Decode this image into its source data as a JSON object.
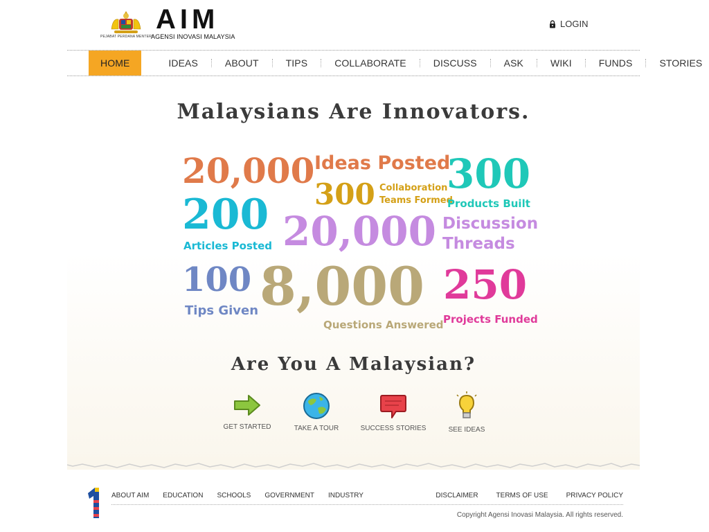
{
  "header": {
    "crest_caption": "PEJABAT PERDANA MENTERI",
    "logo_title": "AIM",
    "logo_subtitle": "AGENSI INOVASI MALAYSIA",
    "login_label": "LOGIN",
    "login_icon": "lock-icon"
  },
  "nav": {
    "items": [
      {
        "label": "HOME",
        "active": true
      },
      {
        "label": "IDEAS"
      },
      {
        "label": "ABOUT"
      },
      {
        "label": "TIPS"
      },
      {
        "label": "COLLABORATE"
      },
      {
        "label": "DISCUSS"
      },
      {
        "label": "ASK"
      },
      {
        "label": "WIKI"
      },
      {
        "label": "FUNDS"
      },
      {
        "label": "STORIES"
      }
    ],
    "active_color": "#f5a623"
  },
  "main": {
    "headline": "Malaysians Are Innovators.",
    "stats": {
      "ideas": {
        "number": "20,000",
        "label": "Ideas Posted",
        "color": "#e07a4a"
      },
      "teams": {
        "number": "300",
        "label_line1": "Collaboration",
        "label_line2": "Teams Formed",
        "color": "#d4a017"
      },
      "products": {
        "number": "300",
        "label": "Products Built",
        "color": "#1fc8b8"
      },
      "articles": {
        "number": "200",
        "label": "Articles Posted",
        "color": "#1ab9d4"
      },
      "discussions": {
        "number": "20,000",
        "label_line1": "Discussion",
        "label_line2": "Threads",
        "color": "#c58be0"
      },
      "tips": {
        "number": "100",
        "label": "Tips Given",
        "color": "#6f87c4"
      },
      "questions": {
        "number": "8,000",
        "label": "Questions Answered",
        "color": "#b9a878"
      },
      "projects": {
        "number": "250",
        "label": "Projects Funded",
        "color": "#e03a9a"
      }
    },
    "subheadline": "Are You A Malaysian?",
    "ctas": [
      {
        "label": "GET STARTED",
        "icon": "arrow-right-icon"
      },
      {
        "label": "TAKE A TOUR",
        "icon": "globe-icon"
      },
      {
        "label": "SUCCESS STORIES",
        "icon": "speech-bubble-icon"
      },
      {
        "label": "SEE IDEAS",
        "icon": "lightbulb-icon"
      }
    ]
  },
  "footer": {
    "left_links": [
      "ABOUT AIM",
      "EDUCATION",
      "SCHOOLS",
      "GOVERNMENT",
      "INDUSTRY"
    ],
    "right_links": [
      "DISCLAIMER",
      "TERMS OF USE",
      "PRIVACY POLICY"
    ],
    "copyright": "Copyright Agensi Inovasi Malaysia. All rights reserved."
  }
}
